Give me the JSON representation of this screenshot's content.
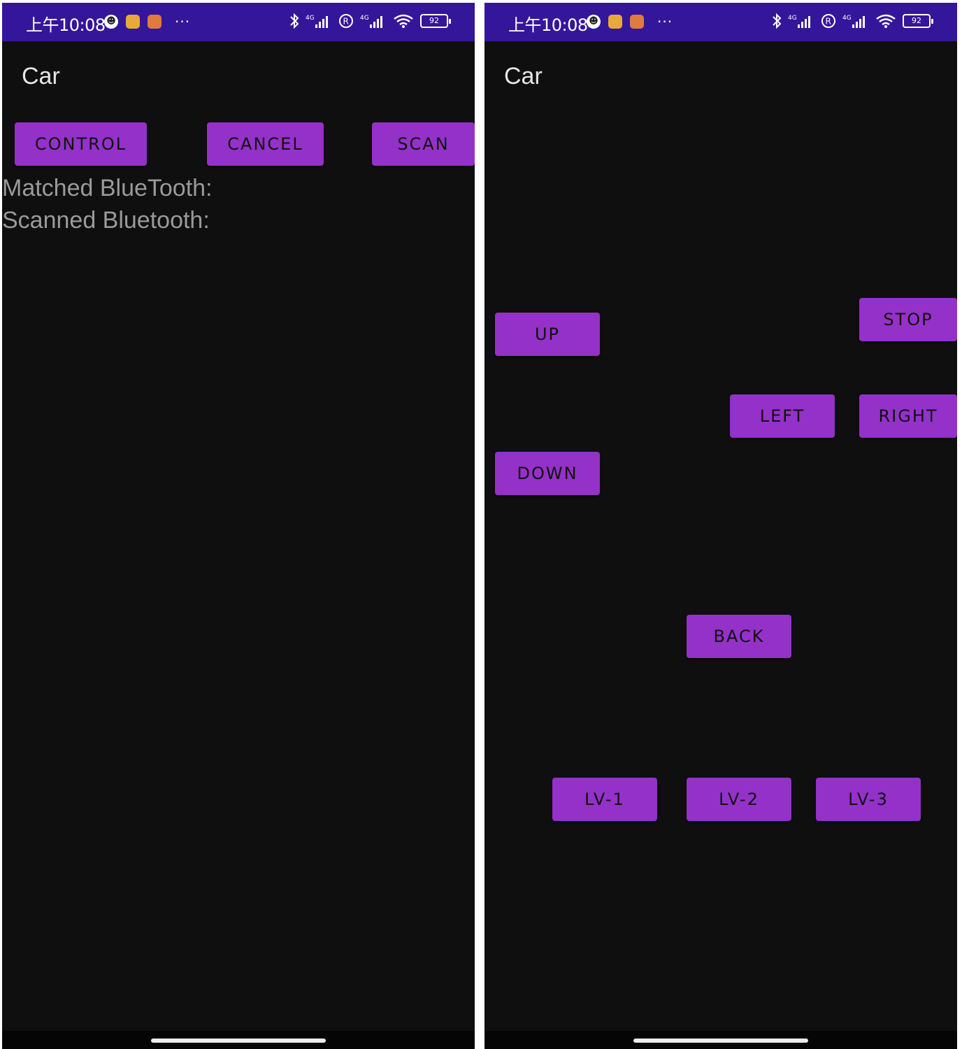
{
  "status_bar": {
    "time": "上午10:08",
    "battery": "92",
    "more": "···",
    "icons": [
      "qq-icon",
      "notes-app-icon",
      "shopping-app-icon",
      "bluetooth-icon",
      "signal-4g-icon",
      "roaming-icon",
      "signal-4g-icon",
      "wifi-icon",
      "battery-icon"
    ],
    "color": "#34169a"
  },
  "app_title": "Car",
  "screen_main": {
    "buttons": {
      "control": "CONTROL",
      "cancel": "CANCEL",
      "scan": "SCAN"
    },
    "matched_label": "Matched BlueTooth:",
    "scanned_label": "Scanned Bluetooth:"
  },
  "screen_control": {
    "buttons": {
      "up": "UP",
      "stop": "STOP",
      "left": "LEFT",
      "right": "RIGHT",
      "down": "DOWN",
      "back": "BACK",
      "lv1": "LV-1",
      "lv2": "LV-2",
      "lv3": "LV-3"
    }
  },
  "colors": {
    "button": "#9431c8",
    "background": "#0f0f10",
    "status_bar": "#34169a"
  }
}
